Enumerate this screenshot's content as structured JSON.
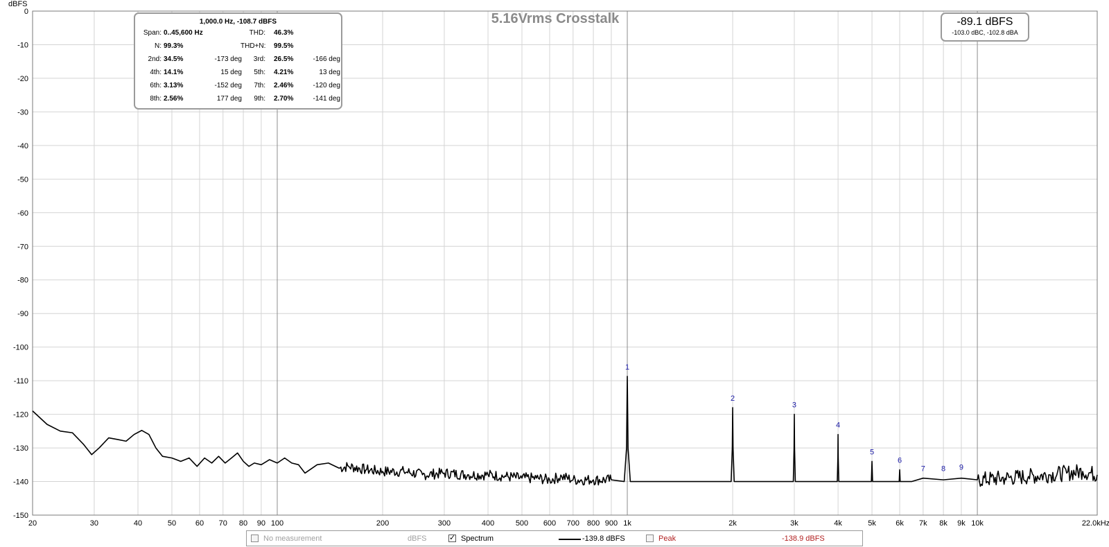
{
  "chart_data": {
    "type": "line",
    "title": "5.16Vrms Crosstalk",
    "ylabel": "dBFS",
    "xlabel": "",
    "x_scale": "log",
    "xlim": [
      20,
      22000
    ],
    "ylim": [
      -150,
      0
    ],
    "grid": true,
    "y_ticks": [
      0,
      -10,
      -20,
      -30,
      -40,
      -50,
      -60,
      -70,
      -80,
      -90,
      -100,
      -110,
      -120,
      -130,
      -140,
      -150
    ],
    "x_ticks": [
      {
        "value": 20,
        "label": "20"
      },
      {
        "value": 30,
        "label": "30"
      },
      {
        "value": 40,
        "label": "40"
      },
      {
        "value": 50,
        "label": "50"
      },
      {
        "value": 60,
        "label": "60"
      },
      {
        "value": 70,
        "label": "70"
      },
      {
        "value": 80,
        "label": "80"
      },
      {
        "value": 90,
        "label": "90"
      },
      {
        "value": 100,
        "label": "100"
      },
      {
        "value": 200,
        "label": "200"
      },
      {
        "value": 300,
        "label": "300"
      },
      {
        "value": 400,
        "label": "400"
      },
      {
        "value": 500,
        "label": "500"
      },
      {
        "value": 600,
        "label": "600"
      },
      {
        "value": 700,
        "label": "700"
      },
      {
        "value": 800,
        "label": "800"
      },
      {
        "value": 900,
        "label": "900"
      },
      {
        "value": 1000,
        "label": "1k"
      },
      {
        "value": 2000,
        "label": "2k"
      },
      {
        "value": 3000,
        "label": "3k"
      },
      {
        "value": 4000,
        "label": "4k"
      },
      {
        "value": 5000,
        "label": "5k"
      },
      {
        "value": 6000,
        "label": "6k"
      },
      {
        "value": 7000,
        "label": "7k"
      },
      {
        "value": 8000,
        "label": "8k"
      },
      {
        "value": 9000,
        "label": "9k"
      },
      {
        "value": 10000,
        "label": "10k"
      },
      {
        "value": 22000,
        "label": "22.0kHz"
      }
    ],
    "series": [
      {
        "color": "#000000",
        "points": [
          [
            20,
            -119.0
          ],
          [
            22,
            -123.0
          ],
          [
            24,
            -125.0
          ],
          [
            26,
            -125.5
          ],
          [
            28,
            -129.0
          ],
          [
            29.5,
            -132.0
          ],
          [
            31,
            -130.0
          ],
          [
            33,
            -127.0
          ],
          [
            35,
            -127.5
          ],
          [
            37,
            -128.0
          ],
          [
            39,
            -126.0
          ],
          [
            41,
            -124.8
          ],
          [
            43,
            -126.0
          ],
          [
            45,
            -130.0
          ],
          [
            47,
            -132.5
          ],
          [
            50,
            -133.0
          ],
          [
            53,
            -134.0
          ],
          [
            56,
            -133.0
          ],
          [
            59,
            -135.5
          ],
          [
            62,
            -133.0
          ],
          [
            65,
            -134.5
          ],
          [
            68,
            -132.5
          ],
          [
            71,
            -134.5
          ],
          [
            74,
            -133.0
          ],
          [
            77,
            -131.5
          ],
          [
            80,
            -134.0
          ],
          [
            83,
            -135.5
          ],
          [
            86,
            -134.5
          ],
          [
            90,
            -135.0
          ],
          [
            95,
            -133.5
          ],
          [
            100,
            -134.5
          ],
          [
            105,
            -133.0
          ],
          [
            110,
            -134.5
          ],
          [
            115,
            -135.0
          ],
          [
            120,
            -137.5
          ],
          [
            130,
            -135.0
          ],
          [
            140,
            -134.5
          ],
          [
            150,
            -136.0
          ],
          [
            160,
            -135.5
          ],
          [
            180,
            -136.5
          ],
          [
            200,
            -137.0
          ],
          [
            230,
            -137.0
          ],
          [
            260,
            -138.0
          ],
          [
            300,
            -137.5
          ],
          [
            350,
            -138.0
          ],
          [
            400,
            -138.0
          ],
          [
            450,
            -138.5
          ],
          [
            500,
            -139.0
          ],
          [
            550,
            -139.0
          ],
          [
            600,
            -139.5
          ],
          [
            650,
            -138.5
          ],
          [
            700,
            -139.5
          ],
          [
            800,
            -139.5
          ],
          [
            900,
            -139.5
          ],
          [
            980,
            -140.0
          ],
          [
            995,
            -130.0
          ],
          [
            1000,
            -108.7
          ],
          [
            1005,
            -130.0
          ],
          [
            1020,
            -140.0
          ],
          [
            1500,
            -140.0
          ],
          [
            1980,
            -140.0
          ],
          [
            1995,
            -130.0
          ],
          [
            2000,
            -118.0
          ],
          [
            2005,
            -130.0
          ],
          [
            2020,
            -140.0
          ],
          [
            2500,
            -140.0
          ],
          [
            2980,
            -140.0
          ],
          [
            2995,
            -130.0
          ],
          [
            3000,
            -120.0
          ],
          [
            3005,
            -130.0
          ],
          [
            3020,
            -140.0
          ],
          [
            3500,
            -140.0
          ],
          [
            3980,
            -140.0
          ],
          [
            3995,
            -133.0
          ],
          [
            4000,
            -126.0
          ],
          [
            4005,
            -133.0
          ],
          [
            4020,
            -140.0
          ],
          [
            4500,
            -140.0
          ],
          [
            4980,
            -140.0
          ],
          [
            5000,
            -134.0
          ],
          [
            5020,
            -140.0
          ],
          [
            5500,
            -140.0
          ],
          [
            5980,
            -140.0
          ],
          [
            6000,
            -136.5
          ],
          [
            6020,
            -140.0
          ],
          [
            6500,
            -140.0
          ],
          [
            7000,
            -139.0
          ],
          [
            8000,
            -139.5
          ],
          [
            9000,
            -139.0
          ],
          [
            10000,
            -139.5
          ],
          [
            12000,
            -139.0
          ],
          [
            14000,
            -138.5
          ],
          [
            16000,
            -138.0
          ],
          [
            18000,
            -137.5
          ],
          [
            20000,
            -137.0
          ],
          [
            22000,
            -138.0
          ]
        ]
      }
    ],
    "annotations": [
      {
        "label": "1",
        "x": 1000,
        "y": -108.7
      },
      {
        "label": "2",
        "x": 2000,
        "y": -118.0
      },
      {
        "label": "3",
        "x": 3000,
        "y": -120.0
      },
      {
        "label": "4",
        "x": 4000,
        "y": -126.0
      },
      {
        "label": "5",
        "x": 5000,
        "y": -134.0
      },
      {
        "label": "6",
        "x": 6000,
        "y": -136.5
      },
      {
        "label": "7",
        "x": 7000,
        "y": -139.0
      },
      {
        "label": "8",
        "x": 8000,
        "y": -139.0
      },
      {
        "label": "9",
        "x": 9000,
        "y": -138.5
      }
    ]
  },
  "info_box": {
    "header": "1,000.0 Hz, -108.7 dBFS",
    "span_label": "Span:",
    "span_value": "0..45,600 Hz",
    "thd_label": "THD:",
    "thd_value": "46.3%",
    "n_label": "N:",
    "n_value": "99.3%",
    "thdn_label": "THD+N:",
    "thdn_value": "99.5%",
    "harmonics": [
      {
        "label": "2nd:",
        "value": "34.5%",
        "phase": "-173 deg",
        "label2": "3rd:",
        "value2": "26.5%",
        "phase2": "-166 deg"
      },
      {
        "label": "4th:",
        "value": "14.1%",
        "phase": "15 deg",
        "label2": "5th:",
        "value2": "4.21%",
        "phase2": "13 deg"
      },
      {
        "label": "6th:",
        "value": "3.13%",
        "phase": "-152 deg",
        "label2": "7th:",
        "value2": "2.46%",
        "phase2": "-120 deg"
      },
      {
        "label": "8th:",
        "value": "2.56%",
        "phase": "177 deg",
        "label2": "9th:",
        "value2": "2.70%",
        "phase2": "-141 deg"
      }
    ]
  },
  "level_box": {
    "main": "-89.1 dBFS",
    "sub": "-103.0 dBC, -102.8 dBA"
  },
  "legend": {
    "no_measurement": "No measurement",
    "no_measurement_value": "dBFS",
    "spectrum": "Spectrum",
    "spectrum_value": "-139.8 dBFS",
    "peak": "Peak",
    "peak_value": "-138.9 dBFS",
    "check_mark": "✓"
  }
}
